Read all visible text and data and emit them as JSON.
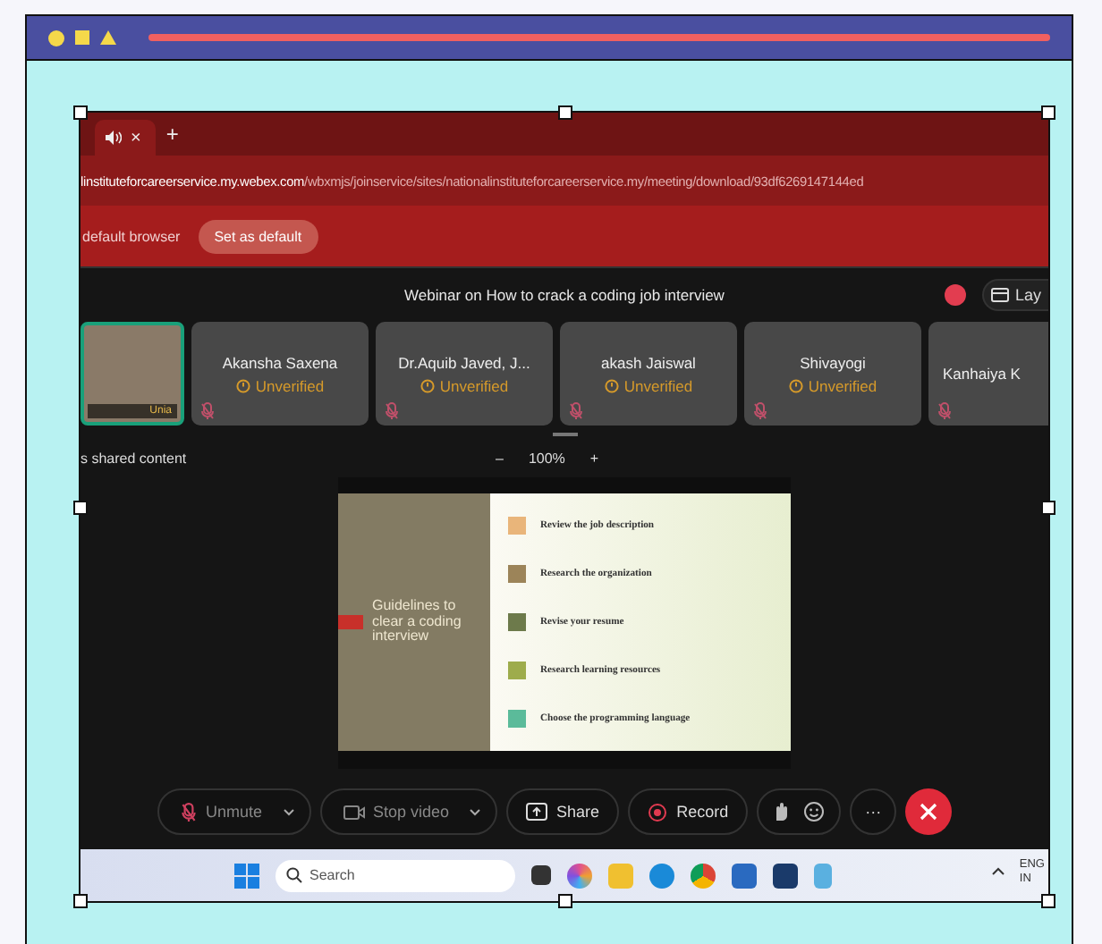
{
  "tab_bar": {
    "close_glyph": "×",
    "new_tab_glyph": "+"
  },
  "address_bar": {
    "domain": "linstituteforcareerservice.my.webex.com",
    "path": "/wbxmjs/joinservice/sites/nationalinstituteforcareerservice.my/meeting/download/93df6269147144ed"
  },
  "info_bar": {
    "message": "default browser",
    "button": "Set as default"
  },
  "meeting": {
    "title": "Webinar on How to crack a coding job interview",
    "layout_button": "Lay",
    "self_view": {
      "label": "Unia"
    },
    "participants": [
      {
        "name": "Akansha Saxena",
        "status": "Unverified"
      },
      {
        "name": "Dr.Aquib Javed, J...",
        "status": "Unverified"
      },
      {
        "name": "akash Jaiswal",
        "status": "Unverified"
      },
      {
        "name": "Shivayogi",
        "status": "Unverified"
      },
      {
        "name": "Kanhaiya K"
      }
    ],
    "shared_label": "s shared content",
    "zoom": {
      "minus": "–",
      "level": "100%",
      "plus": "+"
    },
    "slide": {
      "title": "Guidelines to clear a coding interview",
      "items": [
        {
          "text": "Review the job description",
          "color": "#e9b57a"
        },
        {
          "text": "Research the organization",
          "color": "#9c8459"
        },
        {
          "text": "Revise your resume",
          "color": "#6d7a4b"
        },
        {
          "text": "Research learning resources",
          "color": "#9eac4c"
        },
        {
          "text": "Choose the programming language",
          "color": "#5bbb9a"
        }
      ]
    },
    "controls": [
      {
        "kind": "split",
        "label": "Unmute"
      },
      {
        "kind": "split",
        "label": "Stop video"
      },
      {
        "kind": "button",
        "label": "Share"
      },
      {
        "kind": "button",
        "label": "Record"
      },
      {
        "kind": "icons"
      },
      {
        "kind": "more",
        "label": "···"
      },
      {
        "kind": "end"
      }
    ]
  },
  "taskbar": {
    "search_placeholder": "Search",
    "language": "ENG",
    "region": "IN"
  }
}
